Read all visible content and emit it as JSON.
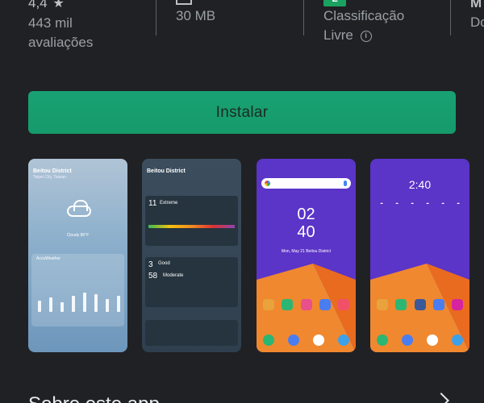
{
  "stats": {
    "rating": {
      "value": "4,4",
      "star": "★",
      "line2a": "443 mil",
      "line2b": "avaliações"
    },
    "size": {
      "value": "30 MB"
    },
    "classification": {
      "badge": "L",
      "line1": "Classificação",
      "line2": "Livre"
    },
    "more": {
      "line1": "M",
      "line2": "Do"
    }
  },
  "install": {
    "label": "Instalar"
  },
  "screenshots": [
    {
      "title": "Beitou District",
      "subtitle": "Taipei City, Taiwan",
      "desc": "Cloudy 86°F",
      "brand": "AccuWeather"
    },
    {
      "title": "Beitou District",
      "uv_num": "11",
      "uv_label": "Extreme",
      "aq_num": "3",
      "aq_label": "Good",
      "aq2_num": "58",
      "aq2_label": "Moderate"
    },
    {
      "hour": "02",
      "minute": "40",
      "date": "Mon, May 21  Beitou District"
    },
    {
      "clock": "2:40"
    }
  ],
  "about": {
    "title": "Sobre este app"
  },
  "colors": {
    "background": "#202124",
    "install_button": "#1aa070",
    "badge_green": "#1aa260"
  }
}
